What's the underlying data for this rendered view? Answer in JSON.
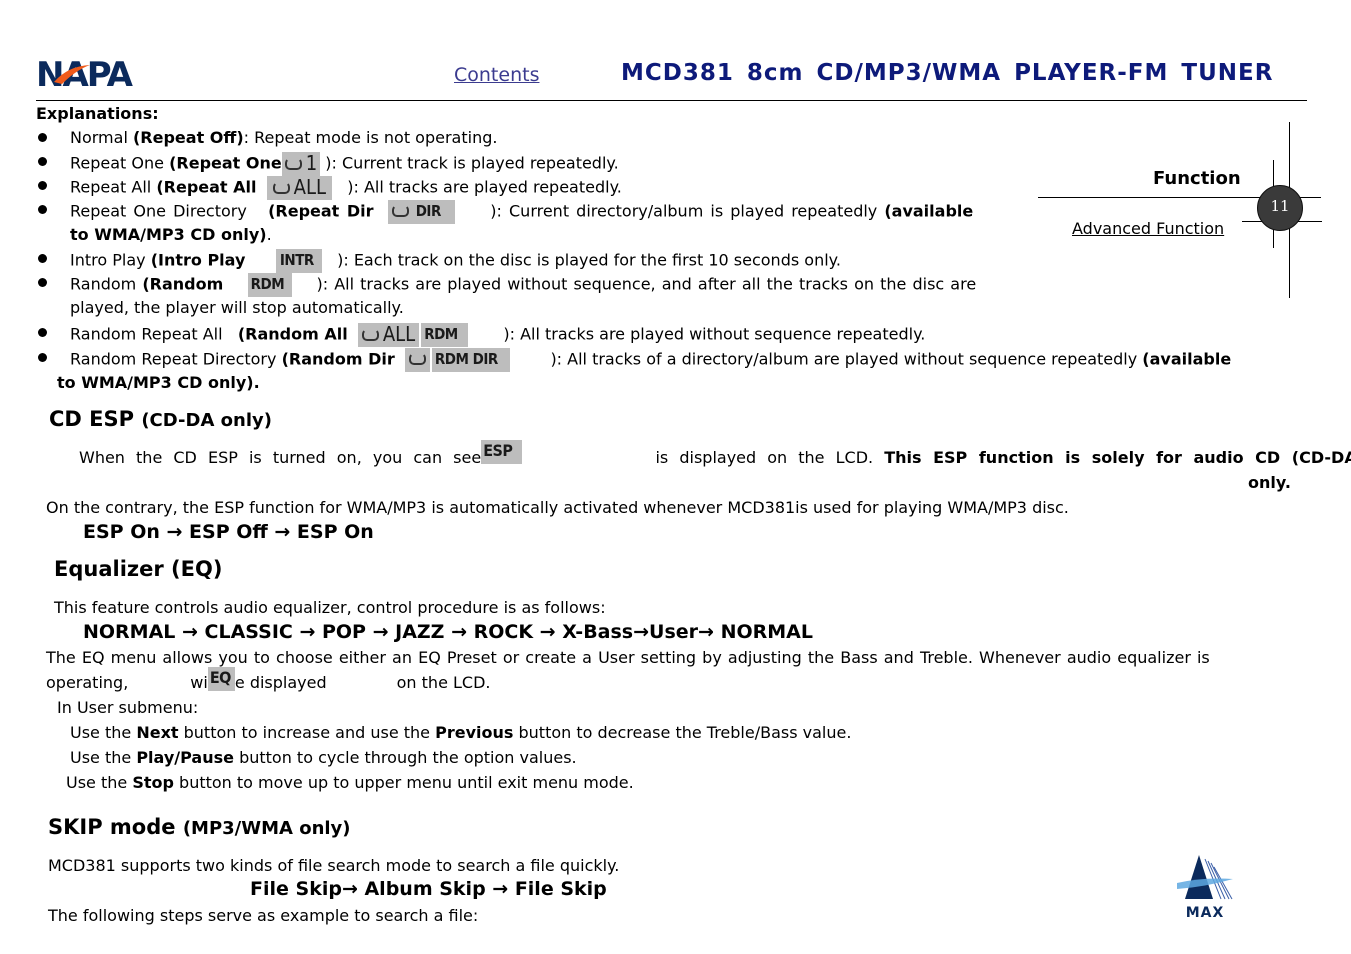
{
  "header": {
    "logo_text": "NAPA",
    "contents_link": "Contents",
    "title": "MCD381 8cm CD/MP3/WMA PLAYER-FM TUNER"
  },
  "side_tab": {
    "section": "Function",
    "subsection": "Advanced Function",
    "page_number": "11"
  },
  "explanations": {
    "heading": "Explanations:",
    "items": [
      {
        "name": "Normal ",
        "mode": "(Repeat Off)",
        "icon": "",
        "desc": ": Repeat mode is not operating.",
        "note": ""
      },
      {
        "name": "Repeat One ",
        "mode": "(Repeat One",
        "icon": "1",
        "desc": "): Current track is played repeatedly.",
        "note": ""
      },
      {
        "name": "Repeat All ",
        "mode": "(Repeat All",
        "icon": "ALL",
        "desc": "): All tracks are played repeatedly.",
        "note": ""
      },
      {
        "name": "Repeat One Directory ",
        "mode": "(Repeat Dir",
        "icon": "DIR",
        "desc": "): Current directory/album is played repeatedly ",
        "note": "(available to WMA/MP3 CD only)"
      },
      {
        "name": "Intro Play ",
        "mode": "(Intro Play",
        "icon": "INTR",
        "desc": "): Each track on the disc is played for the first 10 seconds only.",
        "note": ""
      },
      {
        "name": "Random ",
        "mode": "(Random",
        "icon": "RDM",
        "desc": "): All tracks are played without sequence, and after all the tracks on the disc are",
        "desc2": "played, the player will stop automatically.",
        "note": ""
      },
      {
        "name": "Random Repeat All ",
        "mode": "(Random All",
        "icon": "ALL",
        "icon2": "RDM",
        "desc": "): All tracks are played without sequence repeatedly.",
        "note": ""
      },
      {
        "name": "Random Repeat Directory ",
        "mode": "(Random Dir",
        "icon": "RDM DIR",
        "desc": "): All tracks of a directory/album are played without sequence repeatedly ",
        "note": "(available",
        "note2": "to WMA/MP3 CD only)."
      }
    ]
  },
  "cd_esp": {
    "title": "CD ESP",
    "subtitle": "(CD-DA only)",
    "line1_a": "When the CD ESP is turned on, you can see",
    "lcd": "ESP",
    "line1_b": "is displayed on the LCD.",
    "line1_bold": "This ESP function is solely for audio CD (CD-DA)",
    "line1_end": "only.",
    "line2": "On the contrary, the ESP function for WMA/MP3 is automatically activated whenever MCD381is used for playing WMA/MP3 disc.",
    "flow": "ESP On → ESP Off → ESP On"
  },
  "equalizer": {
    "title": "Equalizer (EQ)",
    "intro": "This feature controls audio equalizer, control procedure is as follows:",
    "flow": "NORMAL → CLASSIC → POP → JAZZ → ROCK → X-Bass→User→ NORMAL",
    "para1": "The EQ menu allows you to choose either an EQ Preset or create a User setting by adjusting the Bass and Treble. Whenever audio equalizer is",
    "para2_a": "operating,",
    "para2_b": "wi",
    "lcd": "EQ",
    "para2_c": "e displayed",
    "para2_d": "on the LCD.",
    "submenu_heading": "In User submenu:",
    "steps": [
      {
        "pre": "Use the ",
        "bold": "Next",
        "mid": " button to increase and use the ",
        "bold2": "Previous",
        "post": " button to decrease the Treble/Bass value."
      },
      {
        "pre": "Use the ",
        "bold": "Play/Pause",
        "post": " button to cycle through the option values."
      },
      {
        "pre": "Use the ",
        "bold": "Stop",
        "post": " button to move up to upper menu until exit menu mode."
      }
    ]
  },
  "skip_mode": {
    "title": "SKIP mode",
    "subtitle": "(MP3/WMA only)",
    "intro": "MCD381 supports two kinds of file search mode to search a file quickly.",
    "flow": "File Skip→ Album Skip → File Skip",
    "outro": "The following steps serve as example to search a file:"
  },
  "footer": {
    "logo_text": "MAX"
  },
  "colors": {
    "title_blue": "#0d1a7a",
    "napa_blue": "#0b2a5c",
    "napa_orange": "#f05a1a",
    "lcd_gray": "#bdbdbd"
  }
}
